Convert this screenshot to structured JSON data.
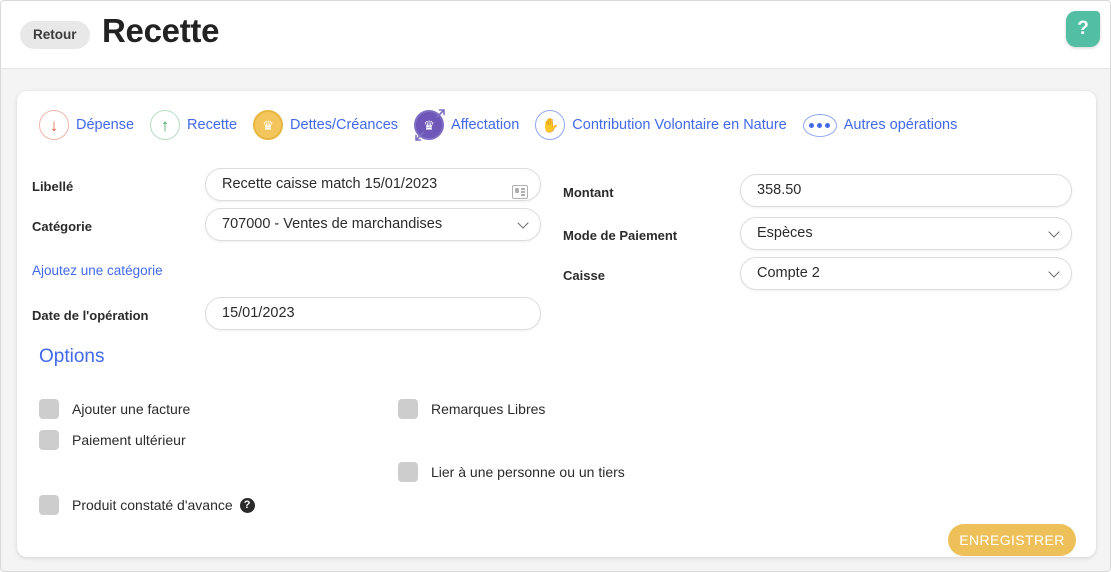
{
  "header": {
    "back_label": "Retour",
    "title": "Recette",
    "help_icon": "question-mark-icon",
    "help_glyph": "?"
  },
  "tabs": [
    {
      "label": "Dépense",
      "icon": "arrow-down-circle-icon",
      "glyph": "↓",
      "style": "red"
    },
    {
      "label": "Recette",
      "icon": "arrow-up-circle-icon",
      "glyph": "↑",
      "style": "green"
    },
    {
      "label": "Dettes/Créances",
      "icon": "crown-circle-icon",
      "glyph": "♛",
      "style": "gold"
    },
    {
      "label": "Affectation",
      "icon": "crown-expand-icon",
      "glyph": "♛",
      "style": "purple"
    },
    {
      "label": "Contribution Volontaire en Nature",
      "icon": "hand-circle-icon",
      "glyph": "✋",
      "style": "blue"
    },
    {
      "label": "Autres opérations",
      "icon": "ellipsis-circle-icon",
      "glyph": "•••",
      "style": "dots"
    }
  ],
  "form": {
    "libelle": {
      "label": "Libellé",
      "value": "Recette caisse match 15/01/2023",
      "trailing_icon": "contact-card-icon"
    },
    "categorie": {
      "label": "Catégorie",
      "value": "707000 - Ventes de marchandises"
    },
    "add_category_link": "Ajoutez une catégorie",
    "date_operation": {
      "label": "Date de l'opération",
      "value": "15/01/2023"
    },
    "montant": {
      "label": "Montant",
      "value": "358.50"
    },
    "mode_paiement": {
      "label": "Mode de Paiement",
      "value": "Espèces"
    },
    "caisse": {
      "label": "Caisse",
      "value": "Compte 2"
    }
  },
  "options": {
    "title": "Options",
    "items": [
      {
        "label": "Ajouter une facture",
        "checked": false,
        "has_help": false
      },
      {
        "label": "Paiement ultérieur",
        "checked": false,
        "has_help": false
      },
      {
        "label": "Produit constaté d'avance",
        "checked": false,
        "has_help": true,
        "help_glyph": "?"
      },
      {
        "label": "Remarques Libres",
        "checked": false,
        "has_help": false
      },
      {
        "label": "Lier à une personne ou un tiers",
        "checked": false,
        "has_help": false
      }
    ]
  },
  "footer": {
    "save_label": "ENREGISTRER"
  },
  "colors": {
    "accent_blue": "#4169e8",
    "save_gold": "#eec05a",
    "help_teal": "#52bfa4",
    "page_bg": "#f4f4f4",
    "card_bg": "#ffffff"
  }
}
